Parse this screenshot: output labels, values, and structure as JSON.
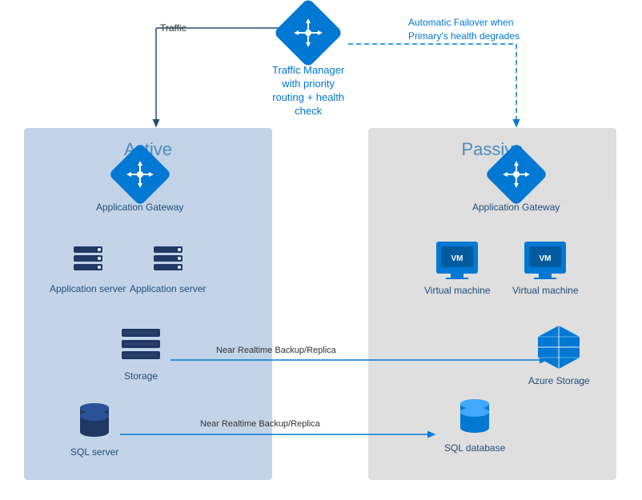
{
  "regions": {
    "active": {
      "label": "Active"
    },
    "passive": {
      "label": "Passive"
    }
  },
  "traffic_manager": {
    "label_line1": "Traffic Manager",
    "label_line2": "with priority",
    "label_line3": "routing + health",
    "label_line4": "check"
  },
  "failover": {
    "text": "Automatic Failover when\nPrimary's health degrades"
  },
  "traffic": {
    "label": "Traffic"
  },
  "active_region": {
    "app_gateway": {
      "label": "Application Gateway"
    },
    "server1": {
      "label": "Application server"
    },
    "server2": {
      "label": "Application server"
    },
    "storage": {
      "label": "Storage"
    }
  },
  "passive_region": {
    "app_gateway": {
      "label": "Application Gateway"
    },
    "vm1": {
      "label": "Virtual machine"
    },
    "vm2": {
      "label": "Virtual machine"
    },
    "az_storage": {
      "label": "Azure Storage"
    },
    "sql_db": {
      "label": "SQL database"
    }
  },
  "sql_server": {
    "label": "SQL server"
  },
  "backup_label1": "Near Realtime Backup/Replica",
  "backup_label2": "Near Realtime Backup/Replica"
}
